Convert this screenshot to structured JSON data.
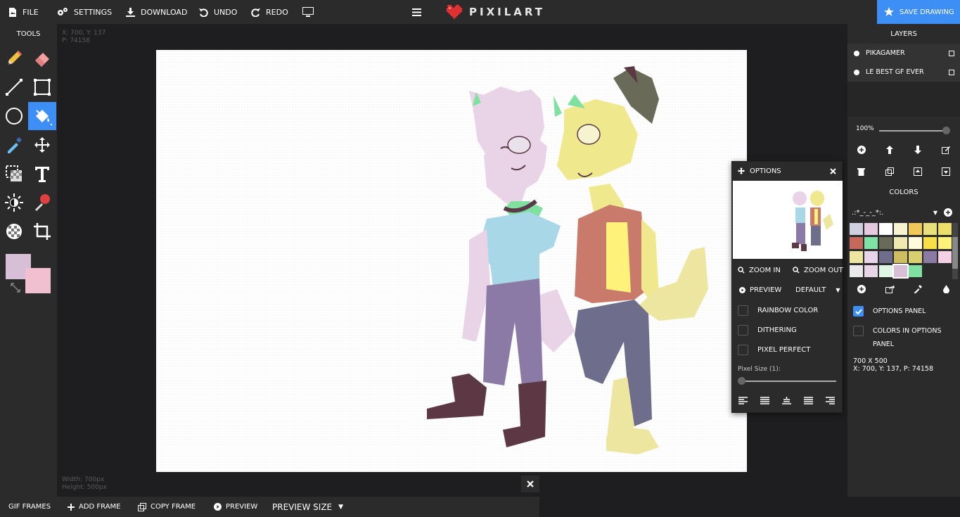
{
  "topbar": {
    "file": "FILE",
    "settings": "SETTINGS",
    "download": "DOWNLOAD",
    "undo": "UNDO",
    "redo": "REDO",
    "logo": "PIXILART",
    "save": "SAVE DRAWING"
  },
  "tools": {
    "title": "TOOLS",
    "items": [
      "pencil",
      "eraser",
      "line",
      "rectangle",
      "circle",
      "fill-bucket",
      "eyedropper",
      "move",
      "select",
      "text",
      "lighten",
      "stamp",
      "checker",
      "crop"
    ],
    "active": "fill-bucket",
    "primary_color": "#d8bfd8",
    "secondary_color": "#f1c0d0"
  },
  "stage": {
    "coord_top": "X: 700, Y: 137",
    "pixels_top": "P: 74158",
    "width_label": "Width: 700px",
    "height_label": "Height: 500px"
  },
  "options": {
    "title": "OPTIONS",
    "zoom_in": "ZOOM IN",
    "zoom_out": "ZOOM OUT",
    "preview": "PREVIEW",
    "preview_mode": "DEFAULT",
    "rainbow": "RAINBOW COLOR",
    "dithering": "DITHERING",
    "pixel_perfect": "PIXEL PERFECT",
    "pixel_size": "Pixel Size (1):"
  },
  "layers": {
    "title": "LAYERS",
    "items": [
      {
        "name": "PIKAGAMER"
      },
      {
        "name": "LE BEST GF EVER"
      }
    ],
    "opacity": "100%",
    "colors_title": "COLORS",
    "palette_name": ".:*_-_-_*:.",
    "palette": [
      "#cfcfe0",
      "#e4c9e0",
      "#ffffff",
      "#f5f3d0",
      "#f0c85a",
      "#e8e07a",
      "#ecde6a",
      "#c6685c",
      "#7ee3a4",
      "#6a6a58",
      "#efe8b0",
      "#fffbdc",
      "#f5e045",
      "#fff27a",
      "#ede6a0",
      "#e8d4e8",
      "#6e6e8c",
      "#cfbe60",
      "#d8d070",
      "#8c7aa6",
      "#f3d0e4",
      "#eaeaea",
      "#e8d4e6",
      "#dff7e4",
      "#d8bfd8",
      "#7fe0a0"
    ],
    "options_panel": "OPTIONS PANEL",
    "colors_in_options": "COLORS IN OPTIONS",
    "colors_in_options2": "PANEL",
    "dims": "700 X 500",
    "coords": "X: 700, Y: 137, P: 74158"
  },
  "bottom": {
    "gif_frames": "GIF FRAMES",
    "add_frame": "ADD FRAME",
    "copy_frame": "COPY FRAME",
    "preview": "PREVIEW",
    "preview_size": "PREVIEW SIZE"
  }
}
